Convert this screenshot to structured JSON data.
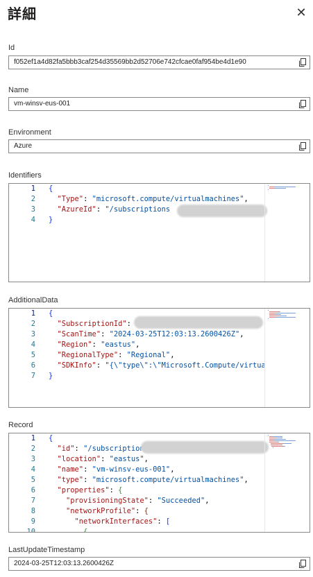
{
  "header": {
    "title": "詳細",
    "close_glyph": "✕"
  },
  "fields": {
    "id": {
      "label": "Id",
      "value": "f052ef1a4d82fa5bbb3caf254d35569bb2d52706e742cfcae0faf954be4d1e90"
    },
    "name": {
      "label": "Name",
      "value": "vm-winsv-eus-001"
    },
    "environment": {
      "label": "Environment",
      "value": "Azure"
    },
    "last_update": {
      "label": "LastUpdateTimestamp",
      "value": "2024-03-25T12:03:13.2600426Z"
    }
  },
  "identifiers": {
    "label": "Identifiers",
    "lines": [
      {
        "n": "1",
        "parts": [
          [
            "b1",
            "{"
          ]
        ]
      },
      {
        "n": "2",
        "parts": [
          [
            "p",
            "  "
          ],
          [
            "k",
            "\"Type\""
          ],
          [
            "p",
            ": "
          ],
          [
            "s",
            "\"microsoft.compute/virtualmachines\""
          ],
          [
            "p",
            ","
          ]
        ]
      },
      {
        "n": "3",
        "parts": [
          [
            "p",
            "  "
          ],
          [
            "k",
            "\"AzureId\""
          ],
          [
            "p",
            ": "
          ],
          [
            "s",
            "\"/subscriptions"
          ]
        ]
      },
      {
        "n": "4",
        "parts": [
          [
            "b1",
            "}"
          ]
        ]
      }
    ]
  },
  "additional_data": {
    "label": "AdditionalData",
    "lines": [
      {
        "n": "1",
        "parts": [
          [
            "b1",
            "{"
          ]
        ]
      },
      {
        "n": "2",
        "parts": [
          [
            "p",
            "  "
          ],
          [
            "k",
            "\"SubscriptionId\""
          ],
          [
            "p",
            ": "
          ]
        ]
      },
      {
        "n": "3",
        "parts": [
          [
            "p",
            "  "
          ],
          [
            "k",
            "\"ScanTime\""
          ],
          [
            "p",
            ": "
          ],
          [
            "s",
            "\"2024-03-25T12:03:13.2600426Z\""
          ],
          [
            "p",
            ","
          ]
        ]
      },
      {
        "n": "4",
        "parts": [
          [
            "p",
            "  "
          ],
          [
            "k",
            "\"Region\""
          ],
          [
            "p",
            ": "
          ],
          [
            "s",
            "\"eastus\""
          ],
          [
            "p",
            ","
          ]
        ]
      },
      {
        "n": "5",
        "parts": [
          [
            "p",
            "  "
          ],
          [
            "k",
            "\"RegionalType\""
          ],
          [
            "p",
            ": "
          ],
          [
            "s",
            "\"Regional\""
          ],
          [
            "p",
            ","
          ]
        ]
      },
      {
        "n": "6",
        "parts": [
          [
            "p",
            "  "
          ],
          [
            "k",
            "\"SDKInfo\""
          ],
          [
            "p",
            ": "
          ],
          [
            "s",
            "\"{\\\"type\\\":\\\"Microsoft.Compute/virtua"
          ]
        ]
      },
      {
        "n": "7",
        "parts": [
          [
            "b1",
            "}"
          ]
        ]
      }
    ]
  },
  "record": {
    "label": "Record",
    "lines": [
      {
        "n": "1",
        "parts": [
          [
            "b1",
            "{"
          ]
        ]
      },
      {
        "n": "2",
        "parts": [
          [
            "p",
            "  "
          ],
          [
            "k",
            "\"id\""
          ],
          [
            "p",
            ": "
          ],
          [
            "s",
            "\"/subscription"
          ]
        ]
      },
      {
        "n": "3",
        "parts": [
          [
            "p",
            "  "
          ],
          [
            "k",
            "\"location\""
          ],
          [
            "p",
            ": "
          ],
          [
            "s",
            "\"eastus\""
          ],
          [
            "p",
            ","
          ]
        ]
      },
      {
        "n": "4",
        "parts": [
          [
            "p",
            "  "
          ],
          [
            "k",
            "\"name\""
          ],
          [
            "p",
            ": "
          ],
          [
            "s",
            "\"vm-winsv-eus-001\""
          ],
          [
            "p",
            ","
          ]
        ]
      },
      {
        "n": "5",
        "parts": [
          [
            "p",
            "  "
          ],
          [
            "k",
            "\"type\""
          ],
          [
            "p",
            ": "
          ],
          [
            "s",
            "\"microsoft.compute/virtualmachines\""
          ],
          [
            "p",
            ","
          ]
        ]
      },
      {
        "n": "6",
        "parts": [
          [
            "p",
            "  "
          ],
          [
            "k",
            "\"properties\""
          ],
          [
            "p",
            ": "
          ],
          [
            "b2",
            "{"
          ]
        ]
      },
      {
        "n": "7",
        "parts": [
          [
            "p",
            "    "
          ],
          [
            "k",
            "\"provisioningState\""
          ],
          [
            "p",
            ": "
          ],
          [
            "s",
            "\"Succeeded\""
          ],
          [
            "p",
            ","
          ]
        ]
      },
      {
        "n": "8",
        "parts": [
          [
            "p",
            "    "
          ],
          [
            "k",
            "\"networkProfile\""
          ],
          [
            "p",
            ": "
          ],
          [
            "b3",
            "{"
          ]
        ]
      },
      {
        "n": "9",
        "parts": [
          [
            "p",
            "      "
          ],
          [
            "k",
            "\"networkInterfaces\""
          ],
          [
            "p",
            ": "
          ],
          [
            "b1",
            "["
          ]
        ]
      },
      {
        "n": "10",
        "parts": [
          [
            "p",
            "        "
          ],
          [
            "b2",
            "{"
          ]
        ]
      }
    ]
  },
  "colors": {
    "json_key": "#a31515",
    "json_string": "#0451a5",
    "line_number": "#237893",
    "border": "#8a8886"
  },
  "icons": {
    "copy": "copy-icon",
    "close": "close-icon"
  }
}
